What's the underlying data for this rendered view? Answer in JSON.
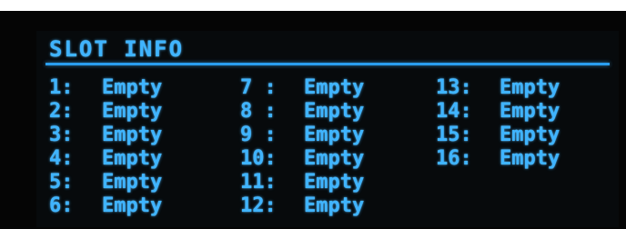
{
  "display": {
    "title": "SLOT INFO",
    "text_color": "#3fb4ff",
    "background": "#070a0c"
  },
  "slots": {
    "columns": [
      [
        {
          "num": "1:",
          "value": "Empty"
        },
        {
          "num": "2:",
          "value": "Empty"
        },
        {
          "num": "3:",
          "value": "Empty"
        },
        {
          "num": "4:",
          "value": "Empty"
        },
        {
          "num": "5:",
          "value": "Empty"
        },
        {
          "num": "6:",
          "value": "Empty"
        }
      ],
      [
        {
          "num": "7 :",
          "value": "Empty"
        },
        {
          "num": "8 :",
          "value": "Empty"
        },
        {
          "num": "9 :",
          "value": "Empty"
        },
        {
          "num": "10:",
          "value": "Empty"
        },
        {
          "num": "11:",
          "value": "Empty"
        },
        {
          "num": "12:",
          "value": "Empty"
        }
      ],
      [
        {
          "num": "13:",
          "value": "Empty"
        },
        {
          "num": "14:",
          "value": "Empty"
        },
        {
          "num": "15:",
          "value": "Empty"
        },
        {
          "num": "16:",
          "value": "Empty"
        }
      ]
    ]
  }
}
